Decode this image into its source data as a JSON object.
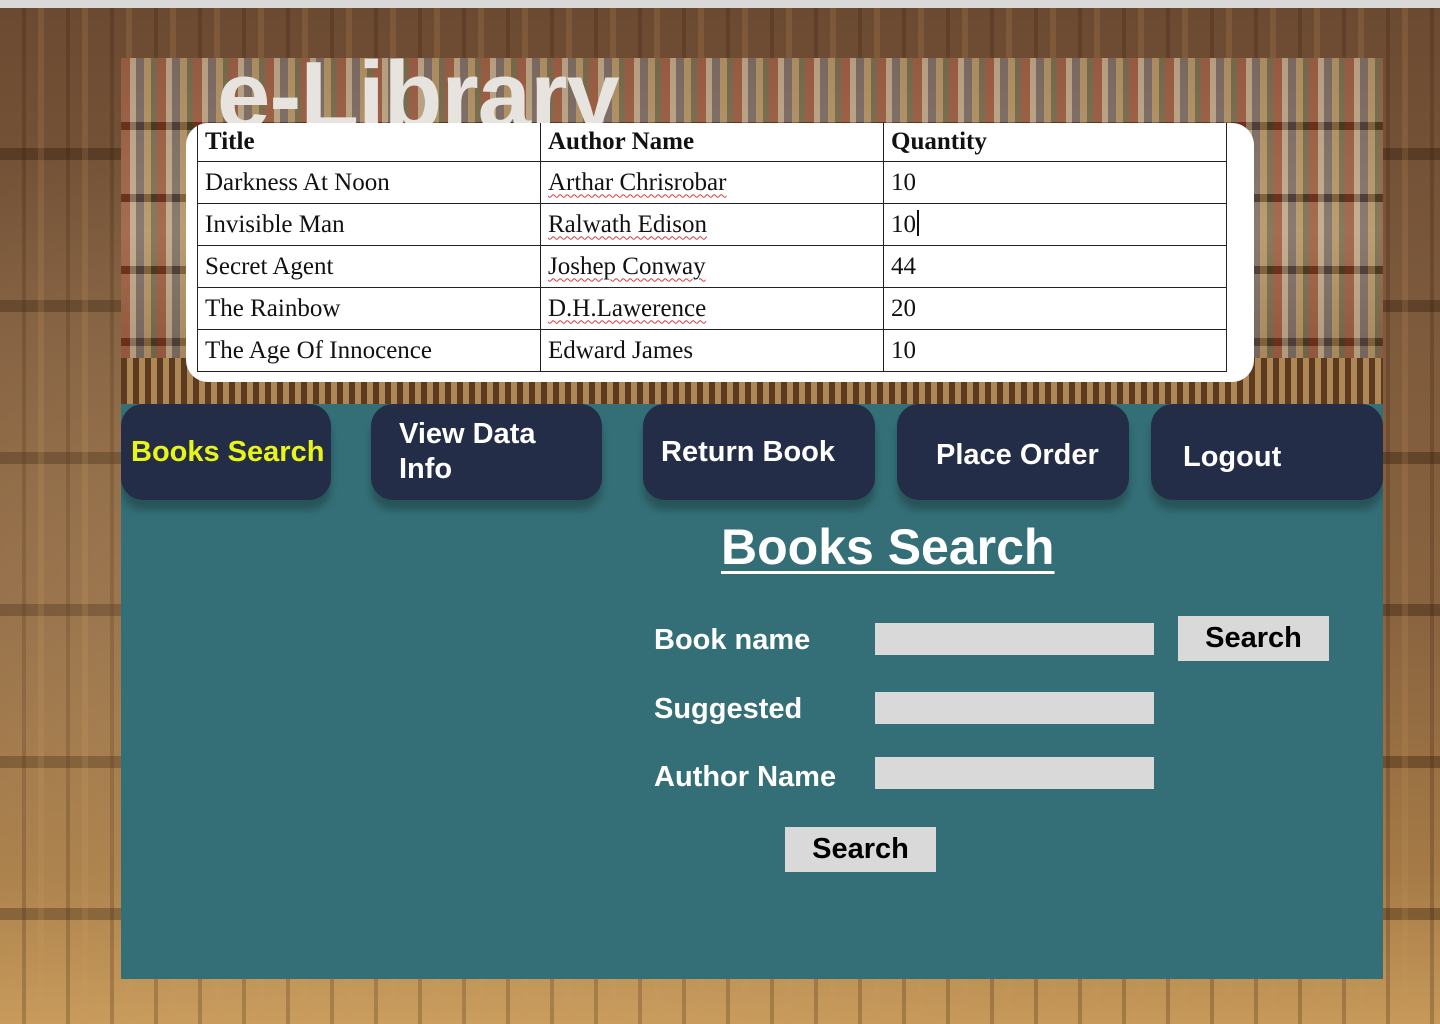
{
  "app": {
    "logo": "e-Library"
  },
  "books_table": {
    "headers": [
      "Title",
      "Author Name",
      "Quantity"
    ],
    "rows": [
      [
        "Darkness At Noon",
        "Arthar Chrisrobar",
        "10"
      ],
      [
        "Invisible Man",
        "Ralwath Edison",
        "10"
      ],
      [
        "Secret Agent",
        "Joshep Conway",
        "44"
      ],
      [
        "The Rainbow",
        "D.H.Lawerence",
        "20"
      ],
      [
        "The Age Of Innocence",
        "Edward James",
        "10"
      ]
    ]
  },
  "nav": {
    "items": [
      {
        "label": "Books Search",
        "active": true
      },
      {
        "label": "View Data Info",
        "active": false
      },
      {
        "label": "Return Book",
        "active": false
      },
      {
        "label": "Place Order",
        "active": false
      },
      {
        "label": "Logout",
        "active": false
      }
    ]
  },
  "search": {
    "title": "Books Search",
    "book_name_label": "Book name",
    "book_name_value": "",
    "suggested_label": "Suggested",
    "suggested_value": "",
    "author_name_label": "Author Name",
    "author_name_value": "",
    "inline_search_label": "Search",
    "search_label": "Search"
  },
  "colors": {
    "panel": "#346f77",
    "nav_button": "#242d47",
    "active_nav_text": "#e8f519",
    "input_bg": "#d9d9d9"
  }
}
